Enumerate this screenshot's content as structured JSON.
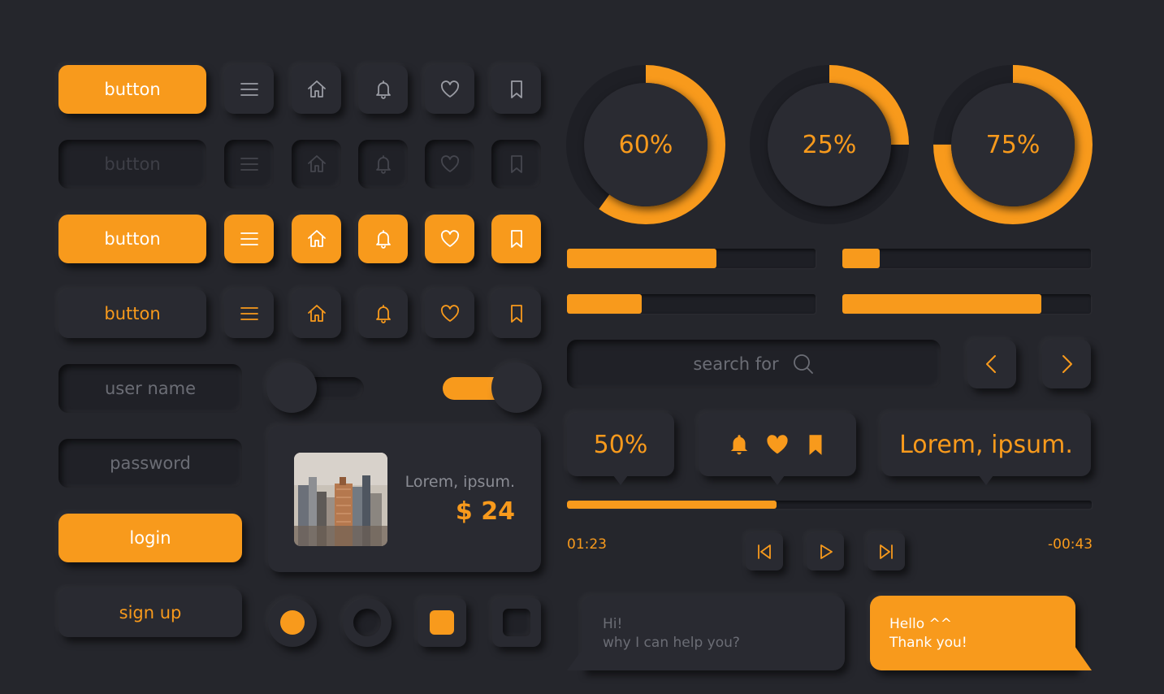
{
  "buttons": {
    "row1_label": "button",
    "row2_label": "button",
    "row3_label": "button",
    "row4_label": "button"
  },
  "icons": [
    "menu-icon",
    "home-icon",
    "bell-icon",
    "heart-icon",
    "bookmark-icon"
  ],
  "form": {
    "username_placeholder": "user name",
    "password_placeholder": "password",
    "login_label": "login",
    "signup_label": "sign up"
  },
  "toggles": {
    "first_on": false,
    "second_on": true
  },
  "product_card": {
    "title": "Lorem, ipsum.",
    "price": "$ 24"
  },
  "radios": {
    "first_checked": true,
    "second_checked": false
  },
  "checkboxes": {
    "first_checked": true,
    "second_checked": false
  },
  "rings": [
    {
      "label": "60%",
      "value": 0.6
    },
    {
      "label": "25%",
      "value": 0.25
    },
    {
      "label": "75%",
      "value": 0.75
    }
  ],
  "progress_bars": [
    0.6,
    0.15,
    0.3,
    0.8
  ],
  "search": {
    "placeholder": "search for"
  },
  "bubbles": {
    "percent": "50%",
    "text": "Lorem, ipsum."
  },
  "player": {
    "elapsed": "01:23",
    "remaining": "-00:43",
    "progress": 0.4
  },
  "chat": {
    "incoming_line1": "Hi!",
    "incoming_line2": "why I can help you?",
    "outgoing_line1": "Hello ^^",
    "outgoing_line2": "Thank you!"
  },
  "colors": {
    "accent": "#f89a1c",
    "background": "#25262c",
    "surface": "#292a31"
  }
}
